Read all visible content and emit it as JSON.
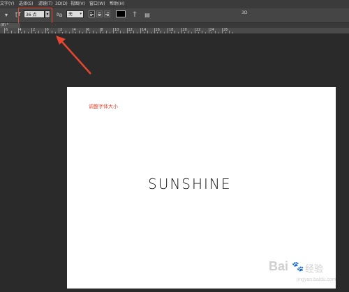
{
  "menubar": {
    "items": [
      "文字(Y)",
      "选择(S)",
      "滤镜(T)",
      "3D(D)",
      "视图(V)",
      "窗口(W)",
      "帮助(H)"
    ]
  },
  "options": {
    "font_size": "36 点",
    "antialias": "无",
    "label_3d": "3D",
    "text_color": "#000000"
  },
  "document_tab": {
    "label": "(8) *"
  },
  "ruler": {
    "labels": [
      "6",
      "4",
      "2",
      "0",
      "2",
      "4",
      "6",
      "8",
      "10",
      "12",
      "14",
      "16",
      "18",
      "20",
      "22",
      "24",
      "26"
    ]
  },
  "canvas": {
    "annotation": "调整字体大小",
    "headline": "SUNSHINE",
    "annotation_color": "#e8462f"
  },
  "watermark": {
    "brand": "Bai",
    "brand_suffix": "经验",
    "url": "jingyan.baidu.com"
  }
}
